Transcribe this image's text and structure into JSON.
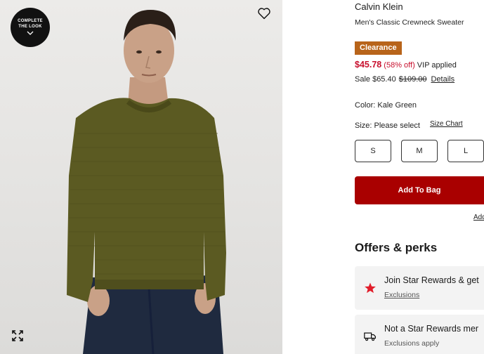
{
  "image": {
    "complete_look": {
      "line1": "COMPLETE",
      "line2": "THE LOOK"
    },
    "icons": {
      "wishlist": "heart-outline-icon",
      "expand": "expand-arrows-icon",
      "chevron": "chevron-down-icon"
    }
  },
  "product": {
    "brand": "Calvin Klein",
    "name": "Men's Classic Crewneck Sweater",
    "badge": "Clearance",
    "price_now": "$45.78",
    "discount": "(58% off)",
    "vip_text": "VIP applied",
    "sale_text": "Sale $65.40",
    "original_price": "$109.00",
    "details_link": "Details",
    "color_text": "Color: Kale Green",
    "size_text": "Size: Please select",
    "size_chart_link": "Size Chart",
    "sizes": [
      "S",
      "M",
      "L"
    ],
    "add_to_bag": "Add To Bag",
    "add_to_list": "Add"
  },
  "offers": {
    "title": "Offers & perks",
    "items": [
      {
        "title": "Join Star Rewards & get",
        "subtitle": "Exclusions",
        "icon": "star-icon"
      },
      {
        "title": "Not a Star Rewards mer",
        "subtitle": "Exclusions apply",
        "icon": "delivery-truck-icon"
      }
    ]
  },
  "colors": {
    "clearance_badge": "#b8641a",
    "sale_red": "#c8102e",
    "add_to_bag": "#a90000",
    "star": "#e11d2a",
    "sweater": "#5b5a22"
  }
}
